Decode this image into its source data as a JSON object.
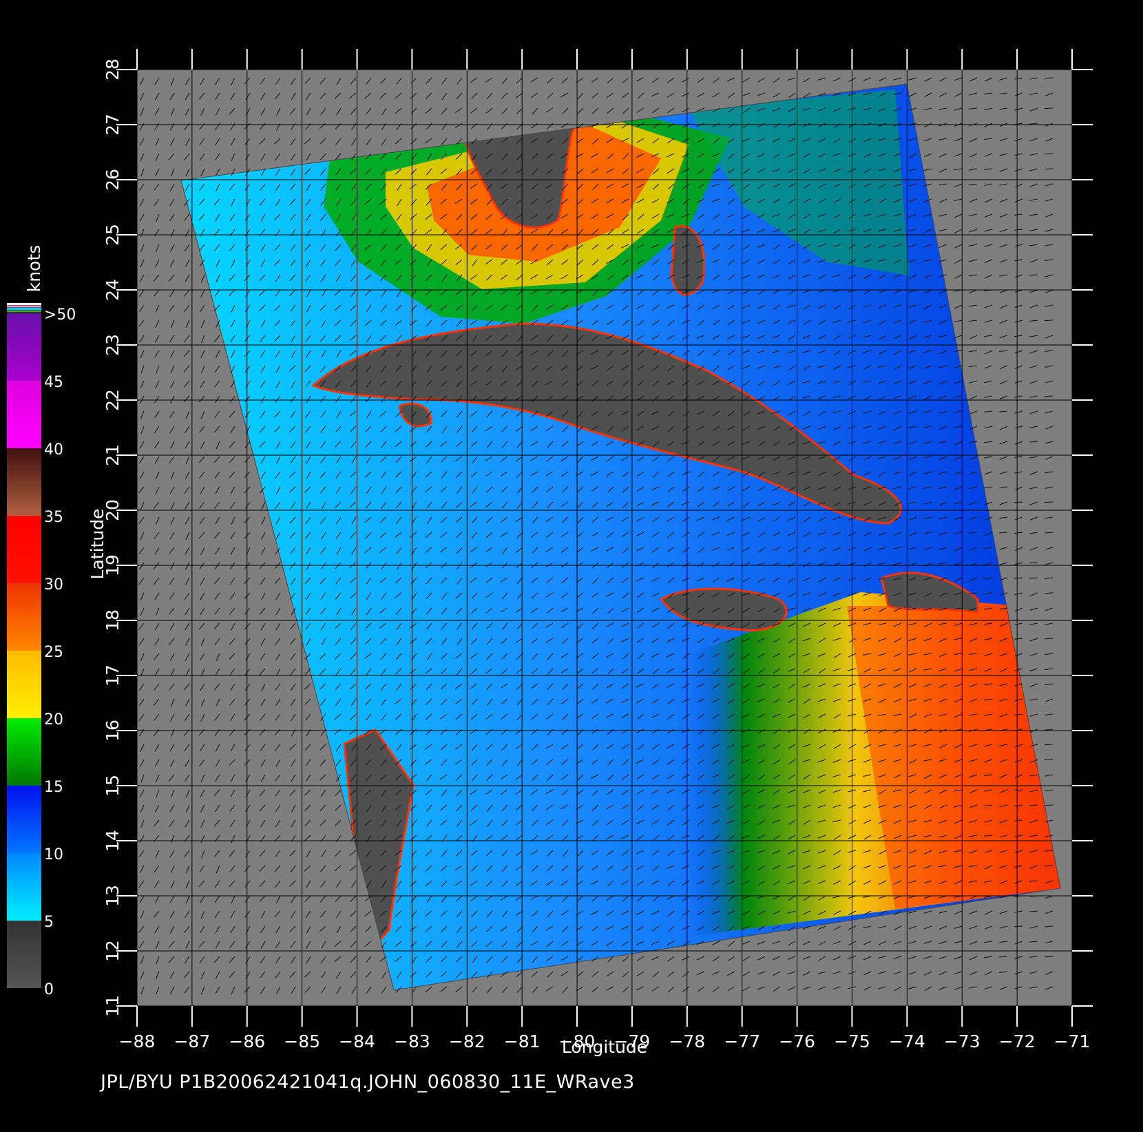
{
  "units_label": "knots",
  "footer": "JPL/BYU  P1B20062421041q.JOHN_060830_11E_WRave3",
  "axes": {
    "xlabel": "Longitude",
    "ylabel": "Latitude",
    "lon_range": [
      -88,
      -71
    ],
    "lat_range": [
      11,
      28
    ],
    "lon_ticks": [
      "-88",
      "-87",
      "-86",
      "-85",
      "-84",
      "-83",
      "-82",
      "-81",
      "-80",
      "-79",
      "-78",
      "-77",
      "-76",
      "-75",
      "-74",
      "-73",
      "-72",
      "-71"
    ],
    "lat_ticks": [
      "11",
      "12",
      "13",
      "14",
      "15",
      "16",
      "17",
      "18",
      "19",
      "20",
      "21",
      "22",
      "23",
      "24",
      "25",
      "26",
      "27",
      "28"
    ]
  },
  "colorbar": {
    "labels": [
      "0",
      "5",
      "10",
      "15",
      "20",
      "25",
      "30",
      "35",
      "40",
      "45",
      ">50"
    ],
    "bands": [
      {
        "from": 0,
        "to": 5,
        "c1": "#555555",
        "c2": "#333333"
      },
      {
        "from": 5,
        "to": 10,
        "c1": "#00eeff",
        "c2": "#0088ff"
      },
      {
        "from": 10,
        "to": 15,
        "c1": "#0077ff",
        "c2": "#0011ee"
      },
      {
        "from": 15,
        "to": 20,
        "c1": "#007700",
        "c2": "#00ee00"
      },
      {
        "from": 20,
        "to": 25,
        "c1": "#ffee00",
        "c2": "#ffbb00"
      },
      {
        "from": 25,
        "to": 30,
        "c1": "#ff8800",
        "c2": "#ee3300"
      },
      {
        "from": 30,
        "to": 35,
        "c1": "#ff1100",
        "c2": "#ff0000"
      },
      {
        "from": 35,
        "to": 40,
        "c1": "#b06040",
        "c2": "#401010"
      },
      {
        "from": 40,
        "to": 45,
        "c1": "#ff00ff",
        "c2": "#dd00dd"
      },
      {
        "from": 45,
        "to": 50,
        "c1": "#aa00cc",
        "c2": "#6611aa"
      }
    ]
  },
  "colors": {
    "background": "#000000",
    "plot_fill": "#7f7f7f",
    "land": "#505050",
    "grid": "#000000"
  }
}
